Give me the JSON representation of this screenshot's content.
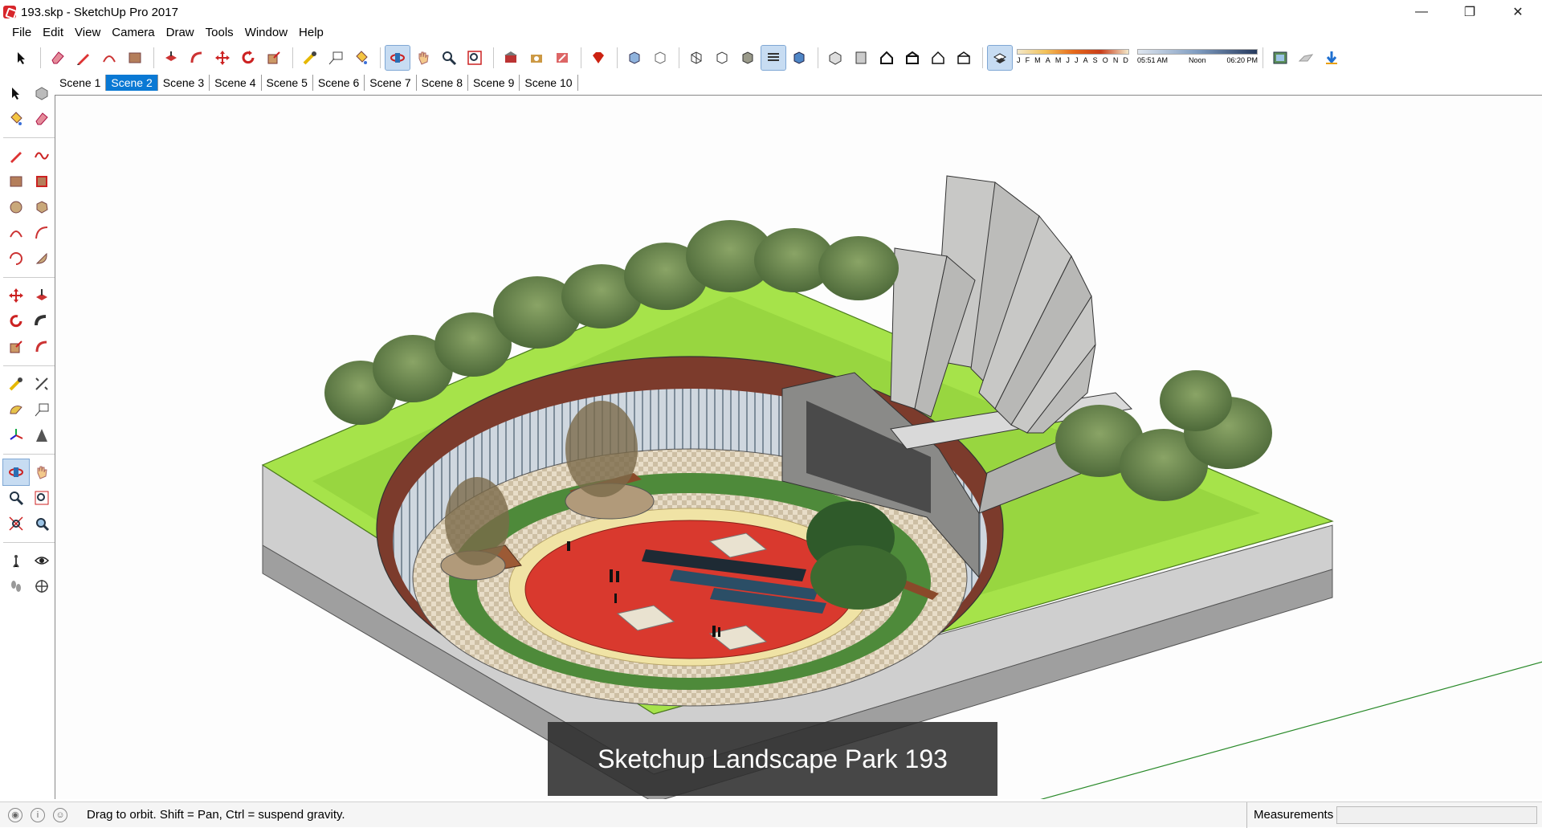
{
  "window": {
    "title": "193.skp - SketchUp Pro 2017",
    "minimize": "—",
    "restore": "❐",
    "close": "✕"
  },
  "menu": [
    "File",
    "Edit",
    "View",
    "Camera",
    "Draw",
    "Tools",
    "Window",
    "Help"
  ],
  "shadow": {
    "months": [
      "J",
      "F",
      "M",
      "A",
      "M",
      "J",
      "J",
      "A",
      "S",
      "O",
      "N",
      "D"
    ],
    "time_start": "05:51 AM",
    "time_mid": "Noon",
    "time_end": "06:20 PM"
  },
  "scenes": {
    "tabs": [
      "Scene 1",
      "Scene 2",
      "Scene 3",
      "Scene 4",
      "Scene 5",
      "Scene 6",
      "Scene 7",
      "Scene 8",
      "Scene 9",
      "Scene 10"
    ],
    "active": "Scene 2"
  },
  "viewport": {
    "caption": "Sketchup Landscape Park 193"
  },
  "status": {
    "hint": "Drag to orbit. Shift = Pan, Ctrl = suspend gravity.",
    "measurements_label": "Measurements",
    "measurements_value": ""
  },
  "colors": {
    "accent": "#0a79d4",
    "grass": "#a6e34a",
    "plaza_red": "#d9392e"
  }
}
